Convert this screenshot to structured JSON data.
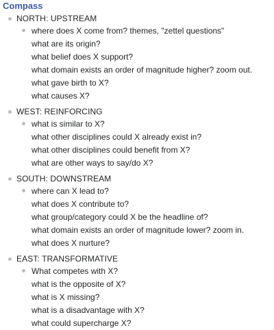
{
  "page": {
    "title": "Compass"
  },
  "sections": [
    {
      "label": "NORTH: UPSTREAM",
      "items": [
        "where does X come from? themes, \"zettel questions\"",
        "what are its origin?",
        "what belief does X support?",
        "what domain exists an order of magnitude higher? zoom out.",
        "what gave birth to X?",
        "what causes X?"
      ]
    },
    {
      "label": "WEST: REINFORCING",
      "items": [
        "what is similar to X?",
        "what other disciplines could X already exist in?",
        "what other disciplines could benefit from X?",
        "what are other ways to say/do X?"
      ]
    },
    {
      "label": "SOUTH: DOWNSTREAM",
      "items": [
        "where can X lead to?",
        "what does X contribute to?",
        "what group/category could X be the headline of?",
        "what domain exists an order of magnitude lower? zoom in.",
        "what does X nurture?"
      ]
    },
    {
      "label": "EAST: TRANSFORMATIVE",
      "items": [
        "What competes with X?",
        "what is the opposite of X?",
        "what is X missing?",
        "what is a disadvantage with X?",
        "what could supercharge X?"
      ]
    }
  ]
}
